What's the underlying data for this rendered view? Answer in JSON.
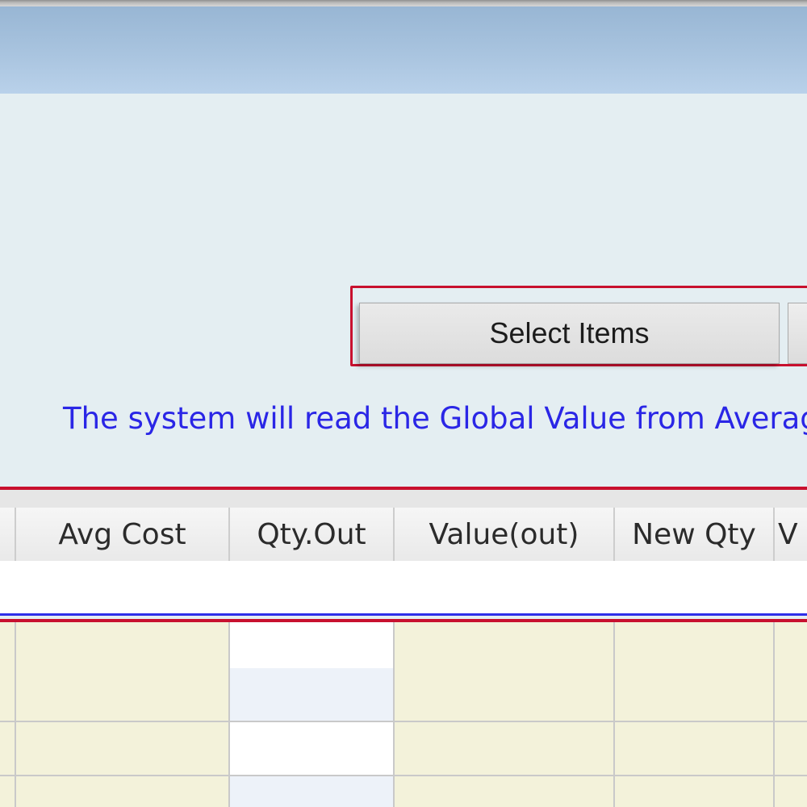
{
  "form": {
    "select_items_label": "Select Items",
    "info_note": "The system will read the Global Value from Average"
  },
  "grid": {
    "columns": [
      "Avg Cost",
      "Qty.Out",
      "Value(out)",
      "New Qty",
      "V"
    ],
    "rows": [
      [
        "",
        "",
        "",
        "",
        ""
      ],
      [
        "",
        "",
        "",
        "",
        ""
      ],
      [
        "",
        "",
        "",
        "",
        ""
      ]
    ]
  },
  "colors": {
    "highlight_red": "#c8102e",
    "note_blue": "#2a26e6",
    "title_bar_blue": "#a9c4df",
    "form_background": "#e4eef2",
    "readonly_cell": "#f3f2da"
  }
}
